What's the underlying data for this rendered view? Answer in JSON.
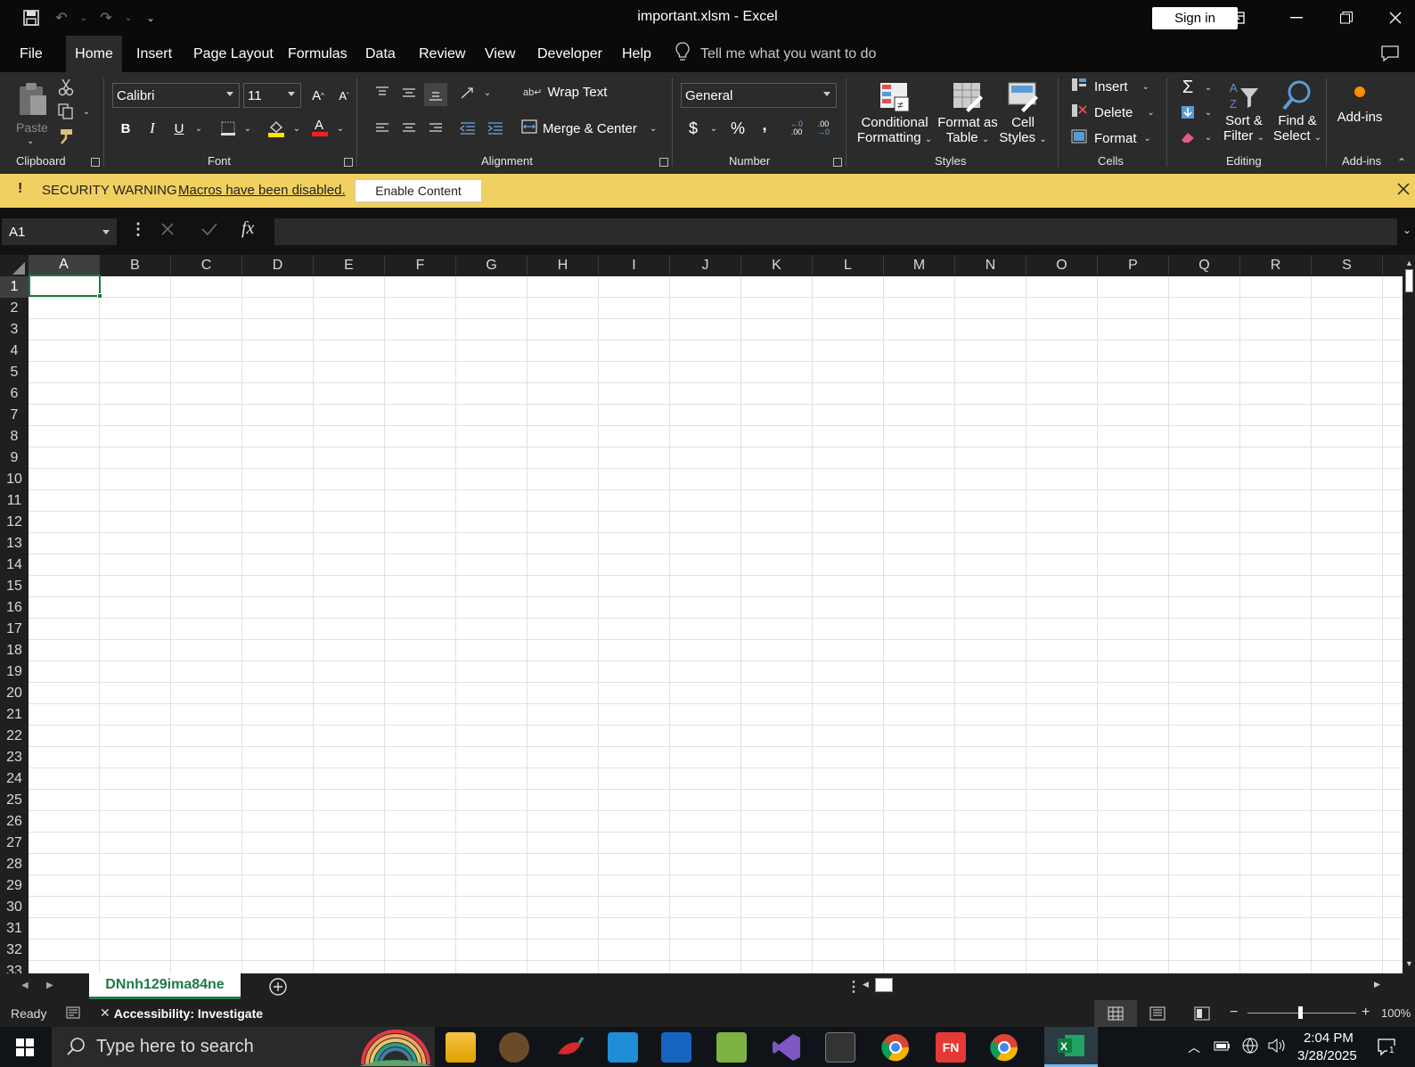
{
  "window": {
    "title": "important.xlsm  -  Excel",
    "sign_in": "Sign in"
  },
  "menu": {
    "tabs": [
      "File",
      "Home",
      "Insert",
      "Page Layout",
      "Formulas",
      "Data",
      "Review",
      "View",
      "Developer",
      "Help"
    ],
    "active": "Home",
    "tell_me": "Tell me what you want to do"
  },
  "ribbon": {
    "clipboard": {
      "label": "Clipboard",
      "paste": "Paste"
    },
    "font": {
      "label": "Font",
      "name": "Calibri",
      "size": "11",
      "bold": "B",
      "italic": "I",
      "underline": "U"
    },
    "alignment": {
      "label": "Alignment",
      "wrap_text": "Wrap Text",
      "merge_center": "Merge & Center"
    },
    "number": {
      "label": "Number",
      "format": "General",
      "currency": "$",
      "percent": "%",
      "comma": ",",
      "inc_decimal": ".00",
      "dec_decimal": ".00"
    },
    "styles": {
      "label": "Styles",
      "conditional_1": "Conditional",
      "conditional_2": "Formatting",
      "format_table_1": "Format as",
      "format_table_2": "Table",
      "cell_styles_1": "Cell",
      "cell_styles_2": "Styles"
    },
    "cells": {
      "label": "Cells",
      "insert": "Insert",
      "delete": "Delete",
      "format": "Format"
    },
    "editing": {
      "label": "Editing",
      "sort_1": "Sort &",
      "sort_2": "Filter",
      "find_1": "Find &",
      "find_2": "Select",
      "autosum": "Σ"
    },
    "addins": {
      "label": "Add-ins",
      "button": "Add-ins"
    }
  },
  "security": {
    "icon": "!",
    "title": "SECURITY WARNING",
    "message": "Macros have been disabled.",
    "button": "Enable Content"
  },
  "formula_bar": {
    "name_box": "A1",
    "fx": "fx",
    "value": ""
  },
  "grid": {
    "columns": [
      "A",
      "B",
      "C",
      "D",
      "E",
      "F",
      "G",
      "H",
      "I",
      "J",
      "K",
      "L",
      "M",
      "N",
      "O",
      "P",
      "Q",
      "R",
      "S"
    ],
    "rows": [
      "1",
      "2",
      "3",
      "4",
      "5",
      "6",
      "7",
      "8",
      "9",
      "10",
      "11",
      "12",
      "13",
      "14",
      "15",
      "16",
      "17",
      "18",
      "19",
      "20",
      "21",
      "22",
      "23",
      "24",
      "25",
      "26",
      "27",
      "28",
      "29",
      "30",
      "31",
      "32",
      "33"
    ],
    "selected_cell": "A1"
  },
  "sheets": {
    "tabs": [
      "DNnh129ima84ne"
    ],
    "active": "DNnh129ima84ne"
  },
  "status": {
    "ready": "Ready",
    "accessibility": "Accessibility: Investigate",
    "zoom": "100%"
  },
  "taskbar": {
    "search_placeholder": "Type here to search",
    "time": "2:04 PM",
    "date": "3/28/2025",
    "notification_count": "1"
  },
  "colors": {
    "excel_green": "#1e7b45",
    "security_bar": "#f0d060",
    "ribbon_bg": "#2b2b2b"
  }
}
